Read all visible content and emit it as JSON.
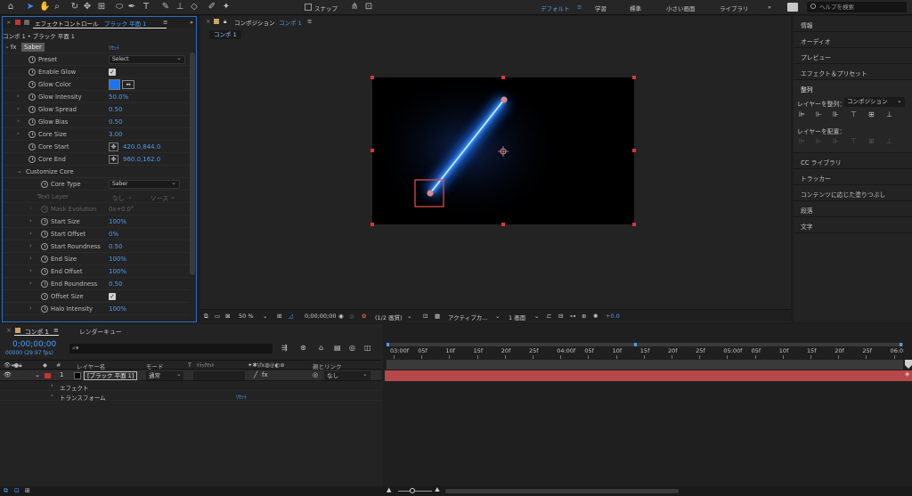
{
  "workspaces": {
    "items": [
      "デフォルト",
      "学習",
      "標準",
      "小さい画面",
      "ライブラリ"
    ],
    "active": "デフォルト"
  },
  "help_search": {
    "placeholder": "ヘルプを検索"
  },
  "toolbar": {
    "snap_label": "スナップ"
  },
  "effect_controls": {
    "tab_title": "エフェクトコントロール",
    "tab_layer": "ブラック 平面 1",
    "breadcrumb": "コンポ 1 • ブラック 平面 1",
    "effect_name": "Saber",
    "reset_label": "ﾘｾｯﾄ",
    "properties": [
      {
        "label": "Preset",
        "type": "dropdown",
        "value": "Select"
      },
      {
        "label": "Enable Glow",
        "type": "checkbox",
        "value": "✓"
      },
      {
        "label": "Glow Color",
        "type": "color",
        "value": ""
      },
      {
        "label": "Glow Intensity",
        "type": "number",
        "value": "50.0%"
      },
      {
        "label": "Glow Spread",
        "type": "number",
        "value": "0.50"
      },
      {
        "label": "Glow Bias",
        "type": "number",
        "value": "0.50"
      },
      {
        "label": "Core Size",
        "type": "number",
        "value": "3.00"
      },
      {
        "label": "Core Start",
        "type": "point",
        "value": "420.0,844.0"
      },
      {
        "label": "Core End",
        "type": "point",
        "value": "960.0,162.0"
      },
      {
        "label": "Customize Core",
        "type": "group",
        "value": ""
      },
      {
        "label": "Core Type",
        "type": "dropdown",
        "value": "Saber"
      },
      {
        "label": "Text Layer",
        "type": "dim-dropdown",
        "value": "なし",
        "value2": "ソース"
      },
      {
        "label": "Mask Evolution",
        "type": "dim",
        "value": "0x+0.0°"
      },
      {
        "label": "Start Size",
        "type": "number",
        "value": "100%"
      },
      {
        "label": "Start Offset",
        "type": "number",
        "value": "0%"
      },
      {
        "label": "Start Roundness",
        "type": "number",
        "value": "0.50"
      },
      {
        "label": "End Size",
        "type": "number",
        "value": "100%"
      },
      {
        "label": "End Offset",
        "type": "number",
        "value": "100%"
      },
      {
        "label": "End Roundness",
        "type": "number",
        "value": "0.50"
      },
      {
        "label": "Offset Size",
        "type": "checkbox",
        "value": "✓"
      },
      {
        "label": "Halo Intensity",
        "type": "number",
        "value": "100%"
      }
    ],
    "glow_color": "#1e74f0"
  },
  "composition": {
    "tab_title": "コンポジション",
    "tab_name": "コンポ 1",
    "sub_tab": "コンポ 1",
    "zoom": "50 %",
    "timecode": "0;00;00;00",
    "resolution": "(1/2 画質)",
    "camera": "アクティブカ...",
    "view": "1 画面",
    "exposure": "+0.0"
  },
  "right_panels": {
    "items": [
      "情報",
      "オーディオ",
      "プレビュー",
      "エフェクト＆プリセット",
      "整列",
      "CC ライブラリ",
      "トラッカー",
      "コンテンツに応じた塗りつぶし",
      "段落",
      "文字"
    ],
    "align": {
      "align_to_label": "レイヤーを整列：",
      "align_to_value": "コンポジション",
      "distribute_label": "レイヤーを配置："
    }
  },
  "timeline": {
    "tab_name": "コンポ 1",
    "render_queue": "レンダーキュー",
    "timecode": "0;00;00;00",
    "fps": "00000 (29.97 fps)",
    "headers": {
      "layer_name": "レイヤー名",
      "mode": "モード",
      "t": "T",
      "trackmatte": "ﾄﾗｯｸﾏｯﾄ",
      "parent": "親とリンク"
    },
    "layer": {
      "number": "1",
      "name": "[ブラック 平面 1]",
      "mode": "通常",
      "parent": "なし"
    },
    "groups": [
      {
        "label": "エフェクト",
        "reset": ""
      },
      {
        "label": "トランスフォーム",
        "reset": "ﾘｾｯﾄ"
      }
    ],
    "ruler": [
      "03:00f",
      "05f",
      "10f",
      "15f",
      "20f",
      "25f",
      "04:00f",
      "05f",
      "10f",
      "15f",
      "20f",
      "25f",
      "05:00f",
      "05f",
      "10f",
      "15f",
      "20f",
      "25f",
      "06:0"
    ],
    "bar_color": "#b7484a"
  }
}
